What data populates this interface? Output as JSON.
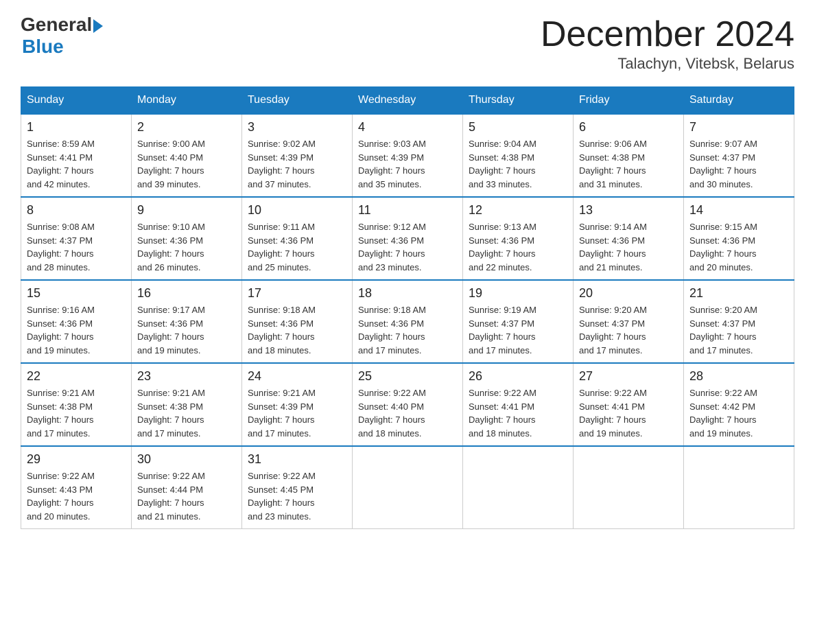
{
  "header": {
    "logo_general": "General",
    "logo_blue": "Blue",
    "month_title": "December 2024",
    "location": "Talachyn, Vitebsk, Belarus"
  },
  "days_of_week": [
    "Sunday",
    "Monday",
    "Tuesday",
    "Wednesday",
    "Thursday",
    "Friday",
    "Saturday"
  ],
  "weeks": [
    [
      {
        "day": "1",
        "sunrise": "8:59 AM",
        "sunset": "4:41 PM",
        "daylight": "7 hours and 42 minutes."
      },
      {
        "day": "2",
        "sunrise": "9:00 AM",
        "sunset": "4:40 PM",
        "daylight": "7 hours and 39 minutes."
      },
      {
        "day": "3",
        "sunrise": "9:02 AM",
        "sunset": "4:39 PM",
        "daylight": "7 hours and 37 minutes."
      },
      {
        "day": "4",
        "sunrise": "9:03 AM",
        "sunset": "4:39 PM",
        "daylight": "7 hours and 35 minutes."
      },
      {
        "day": "5",
        "sunrise": "9:04 AM",
        "sunset": "4:38 PM",
        "daylight": "7 hours and 33 minutes."
      },
      {
        "day": "6",
        "sunrise": "9:06 AM",
        "sunset": "4:38 PM",
        "daylight": "7 hours and 31 minutes."
      },
      {
        "day": "7",
        "sunrise": "9:07 AM",
        "sunset": "4:37 PM",
        "daylight": "7 hours and 30 minutes."
      }
    ],
    [
      {
        "day": "8",
        "sunrise": "9:08 AM",
        "sunset": "4:37 PM",
        "daylight": "7 hours and 28 minutes."
      },
      {
        "day": "9",
        "sunrise": "9:10 AM",
        "sunset": "4:36 PM",
        "daylight": "7 hours and 26 minutes."
      },
      {
        "day": "10",
        "sunrise": "9:11 AM",
        "sunset": "4:36 PM",
        "daylight": "7 hours and 25 minutes."
      },
      {
        "day": "11",
        "sunrise": "9:12 AM",
        "sunset": "4:36 PM",
        "daylight": "7 hours and 23 minutes."
      },
      {
        "day": "12",
        "sunrise": "9:13 AM",
        "sunset": "4:36 PM",
        "daylight": "7 hours and 22 minutes."
      },
      {
        "day": "13",
        "sunrise": "9:14 AM",
        "sunset": "4:36 PM",
        "daylight": "7 hours and 21 minutes."
      },
      {
        "day": "14",
        "sunrise": "9:15 AM",
        "sunset": "4:36 PM",
        "daylight": "7 hours and 20 minutes."
      }
    ],
    [
      {
        "day": "15",
        "sunrise": "9:16 AM",
        "sunset": "4:36 PM",
        "daylight": "7 hours and 19 minutes."
      },
      {
        "day": "16",
        "sunrise": "9:17 AM",
        "sunset": "4:36 PM",
        "daylight": "7 hours and 19 minutes."
      },
      {
        "day": "17",
        "sunrise": "9:18 AM",
        "sunset": "4:36 PM",
        "daylight": "7 hours and 18 minutes."
      },
      {
        "day": "18",
        "sunrise": "9:18 AM",
        "sunset": "4:36 PM",
        "daylight": "7 hours and 17 minutes."
      },
      {
        "day": "19",
        "sunrise": "9:19 AM",
        "sunset": "4:37 PM",
        "daylight": "7 hours and 17 minutes."
      },
      {
        "day": "20",
        "sunrise": "9:20 AM",
        "sunset": "4:37 PM",
        "daylight": "7 hours and 17 minutes."
      },
      {
        "day": "21",
        "sunrise": "9:20 AM",
        "sunset": "4:37 PM",
        "daylight": "7 hours and 17 minutes."
      }
    ],
    [
      {
        "day": "22",
        "sunrise": "9:21 AM",
        "sunset": "4:38 PM",
        "daylight": "7 hours and 17 minutes."
      },
      {
        "day": "23",
        "sunrise": "9:21 AM",
        "sunset": "4:38 PM",
        "daylight": "7 hours and 17 minutes."
      },
      {
        "day": "24",
        "sunrise": "9:21 AM",
        "sunset": "4:39 PM",
        "daylight": "7 hours and 17 minutes."
      },
      {
        "day": "25",
        "sunrise": "9:22 AM",
        "sunset": "4:40 PM",
        "daylight": "7 hours and 18 minutes."
      },
      {
        "day": "26",
        "sunrise": "9:22 AM",
        "sunset": "4:41 PM",
        "daylight": "7 hours and 18 minutes."
      },
      {
        "day": "27",
        "sunrise": "9:22 AM",
        "sunset": "4:41 PM",
        "daylight": "7 hours and 19 minutes."
      },
      {
        "day": "28",
        "sunrise": "9:22 AM",
        "sunset": "4:42 PM",
        "daylight": "7 hours and 19 minutes."
      }
    ],
    [
      {
        "day": "29",
        "sunrise": "9:22 AM",
        "sunset": "4:43 PM",
        "daylight": "7 hours and 20 minutes."
      },
      {
        "day": "30",
        "sunrise": "9:22 AM",
        "sunset": "4:44 PM",
        "daylight": "7 hours and 21 minutes."
      },
      {
        "day": "31",
        "sunrise": "9:22 AM",
        "sunset": "4:45 PM",
        "daylight": "7 hours and 23 minutes."
      },
      null,
      null,
      null,
      null
    ]
  ],
  "labels": {
    "sunrise": "Sunrise:",
    "sunset": "Sunset:",
    "daylight": "Daylight:"
  }
}
